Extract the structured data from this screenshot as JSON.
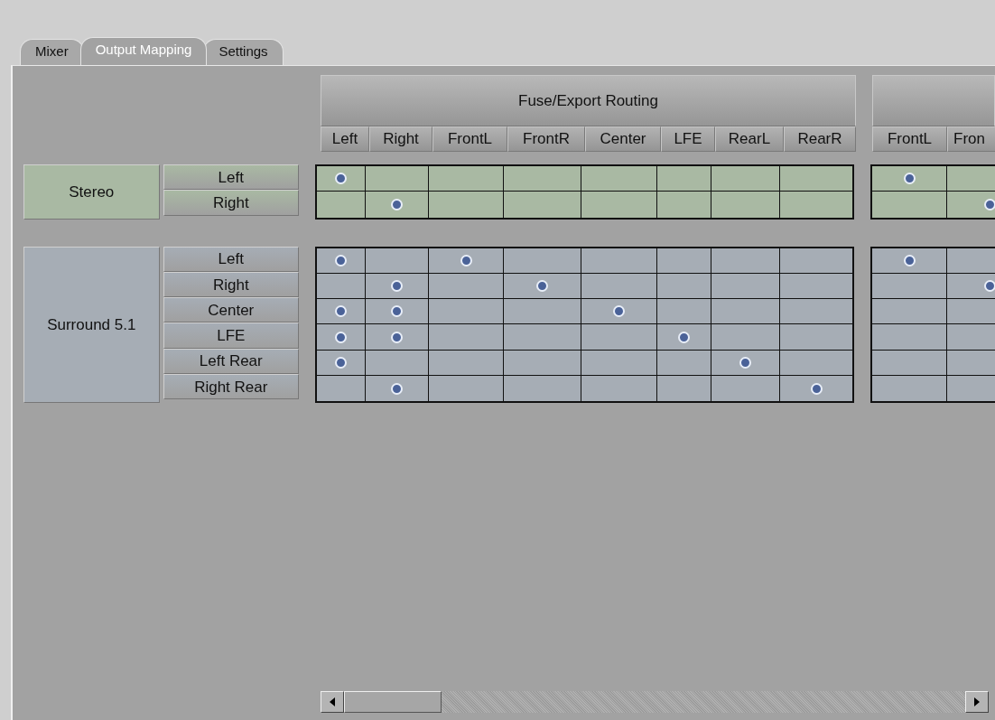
{
  "tabs": [
    {
      "label": "Mixer",
      "selected": false
    },
    {
      "label": "Output Mapping",
      "selected": true
    },
    {
      "label": "Settings",
      "selected": false
    }
  ],
  "buses": [
    {
      "title": "Fuse/Export Routing",
      "columns": [
        "Left",
        "Right",
        "FrontL",
        "FrontR",
        "Center",
        "LFE",
        "RearL",
        "RearR"
      ]
    },
    {
      "columns": [
        "FrontL",
        "Fron"
      ]
    }
  ],
  "groups": [
    {
      "name": "Stereo",
      "color": "#a9b9a3",
      "outputs": [
        {
          "label": "Left",
          "routes": [
            [
              true,
              false,
              false,
              false,
              false,
              false,
              false,
              false
            ],
            [
              true,
              false
            ]
          ]
        },
        {
          "label": "Right",
          "routes": [
            [
              false,
              true,
              false,
              false,
              false,
              false,
              false,
              false
            ],
            [
              false,
              true
            ]
          ]
        }
      ]
    },
    {
      "name": "Surround 5.1",
      "color": "#a6adb5",
      "outputs": [
        {
          "label": "Left",
          "routes": [
            [
              true,
              false,
              true,
              false,
              false,
              false,
              false,
              false
            ],
            [
              true,
              false
            ]
          ]
        },
        {
          "label": "Right",
          "routes": [
            [
              false,
              true,
              false,
              true,
              false,
              false,
              false,
              false
            ],
            [
              false,
              true
            ]
          ]
        },
        {
          "label": "Center",
          "routes": [
            [
              true,
              true,
              false,
              false,
              true,
              false,
              false,
              false
            ],
            [
              false,
              false
            ]
          ]
        },
        {
          "label": "LFE",
          "routes": [
            [
              true,
              true,
              false,
              false,
              false,
              true,
              false,
              false
            ],
            [
              false,
              false
            ]
          ]
        },
        {
          "label": "Left Rear",
          "routes": [
            [
              true,
              false,
              false,
              false,
              false,
              false,
              true,
              false
            ],
            [
              false,
              false
            ]
          ]
        },
        {
          "label": "Right Rear",
          "routes": [
            [
              false,
              true,
              false,
              false,
              false,
              false,
              false,
              true
            ],
            [
              false,
              false
            ]
          ]
        }
      ]
    }
  ]
}
